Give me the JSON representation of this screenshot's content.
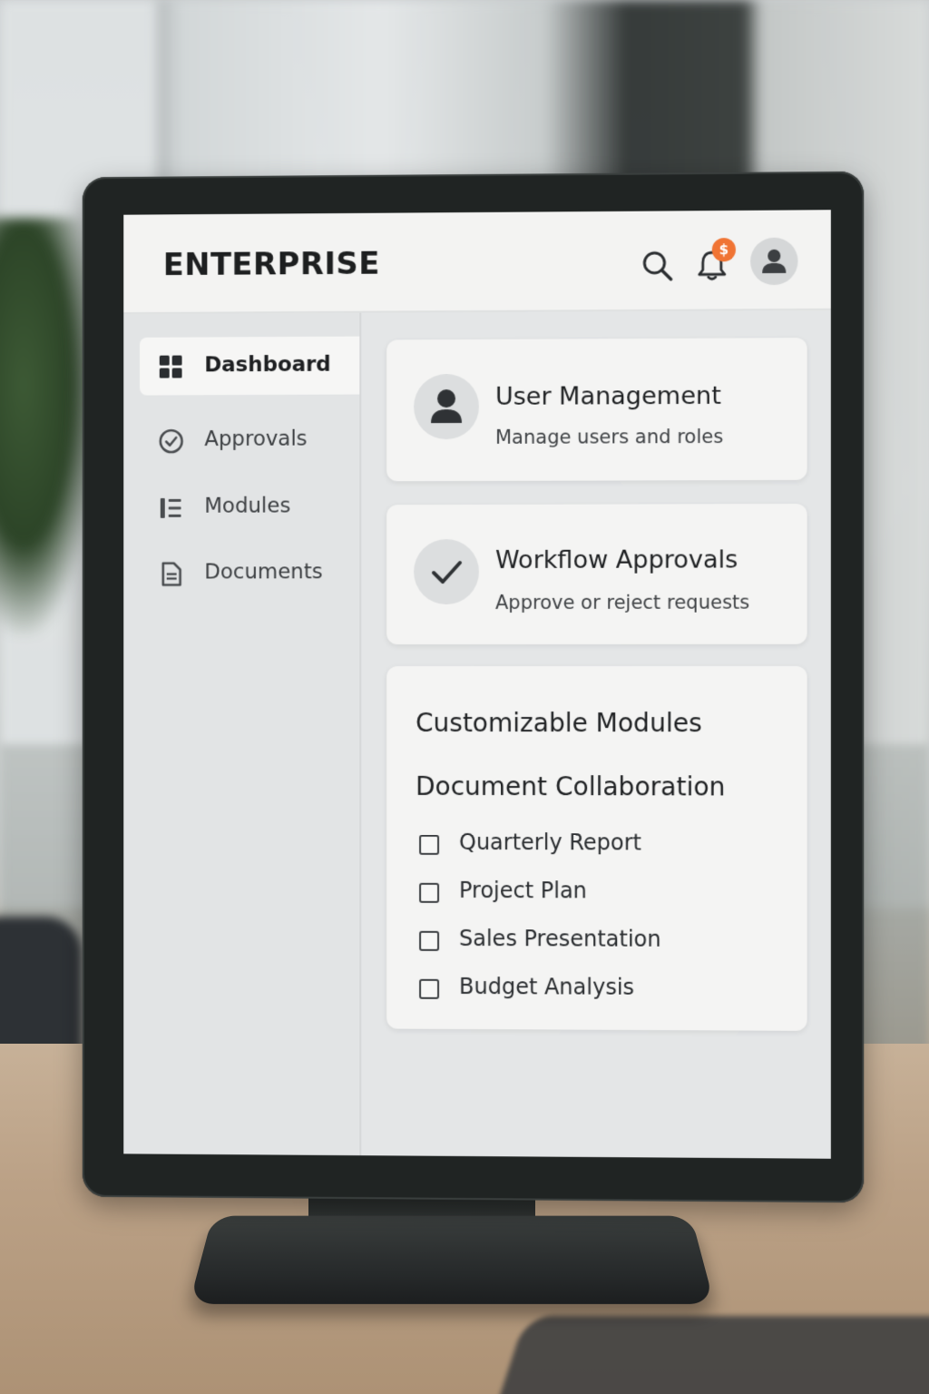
{
  "app": {
    "brand": "ENTERPRISE"
  },
  "header": {
    "icons": [
      "search-icon",
      "bell-icon",
      "avatar-icon"
    ],
    "notification_badge": "$",
    "badge_color": "#f07434"
  },
  "sidebar": {
    "items": [
      {
        "label": "Dashboard",
        "icon": "grid-icon",
        "active": true
      },
      {
        "label": "Approvals",
        "icon": "check-circle-icon",
        "active": false
      },
      {
        "label": "Modules",
        "icon": "list-icon",
        "active": false
      },
      {
        "label": "Documents",
        "icon": "document-icon",
        "active": false
      }
    ]
  },
  "cards": {
    "user_management": {
      "title": "User Management",
      "subtitle": "Manage users and roles",
      "icon": "user-icon"
    },
    "workflow_approvals": {
      "title": "Workflow Approvals",
      "subtitle": "Approve or reject requests",
      "icon": "checkmark-icon"
    },
    "modules": {
      "title": "Customizable Modules",
      "collab_title": "Document Collaboration",
      "documents": [
        {
          "label": "Quarterly Report",
          "checked": false
        },
        {
          "label": "Project Plan",
          "checked": false
        },
        {
          "label": "Sales Presentation",
          "checked": false
        },
        {
          "label": "Budget Analysis",
          "checked": false
        }
      ]
    }
  },
  "colors": {
    "screen_bg": "#e4e6e7",
    "card_bg": "#f4f4f3",
    "text_primary": "#1f2123"
  }
}
